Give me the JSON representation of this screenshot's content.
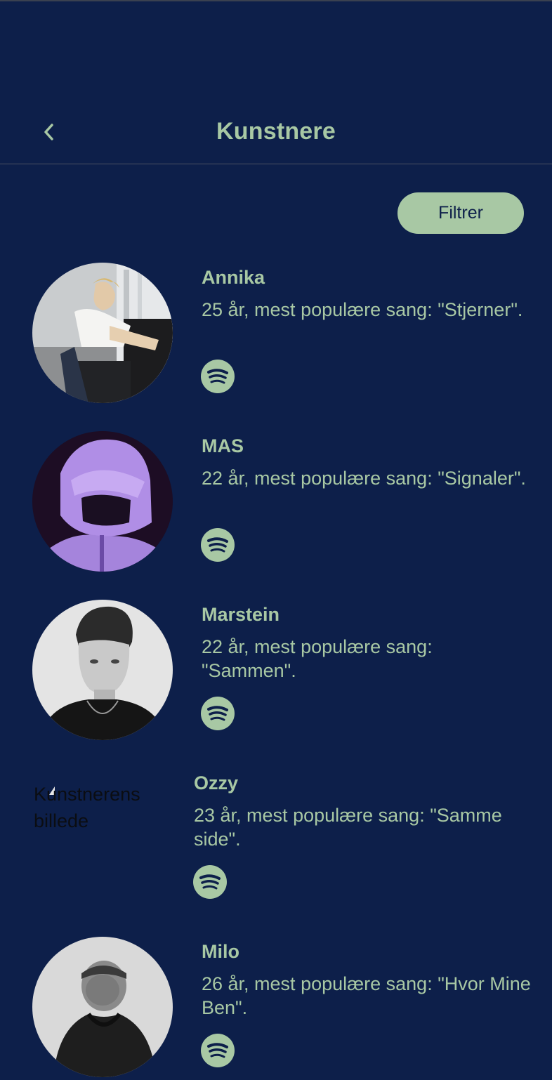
{
  "header": {
    "title": "Kunstnere",
    "back_icon": "chevron-left-icon"
  },
  "filter_button": {
    "label": "Filtrer"
  },
  "colors": {
    "background": "#0d1f4a",
    "accent": "#a8c8a4"
  },
  "artists": [
    {
      "name": "Annika",
      "description": "25 år, mest populære sang: \"Stjerner\".",
      "icon": "spotify-icon"
    },
    {
      "name": "MAS",
      "description": "22 år, mest populære sang: \"Signaler\".",
      "icon": "spotify-icon"
    },
    {
      "name": "Marstein",
      "description": "22 år, mest populære sang: \"Sammen\".",
      "icon": "spotify-icon"
    },
    {
      "name": "Ozzy",
      "description": "23 år, mest populære sang: \"Samme side\".",
      "image_alt": "Kunstnerens billede",
      "icon": "spotify-icon"
    },
    {
      "name": "Milo",
      "description": "26 år, mest populære sang: \"Hvor Mine Ben\".",
      "icon": "spotify-icon"
    }
  ]
}
